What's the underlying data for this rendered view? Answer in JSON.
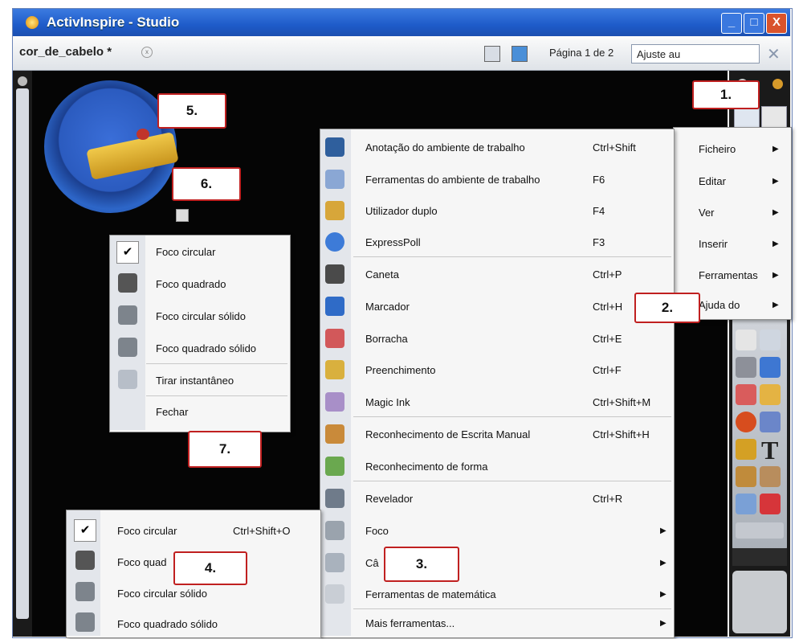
{
  "window": {
    "title": "ActivInspire - Studio",
    "min_label": "_",
    "max_label": "□",
    "close_label": "X"
  },
  "tab": {
    "label": "cor_de_cabelo *",
    "close_label": "x"
  },
  "toolbar": {
    "page_indicator": "Página 1 de 2",
    "zoom_value": "Ajuste au"
  },
  "main_menu": [
    {
      "label": "Ficheiro",
      "arrow": "▶"
    },
    {
      "label": "Editar",
      "arrow": "▶"
    },
    {
      "label": "Ver",
      "arrow": "▶"
    },
    {
      "label": "Inserir",
      "arrow": "▶"
    },
    {
      "label": "Ferramentas",
      "arrow": "▶"
    },
    {
      "label": "Ajuda do",
      "arrow": "▶"
    }
  ],
  "tools_menu": [
    {
      "label": "Anotação do ambiente de trabalho",
      "shortcut": "Ctrl+Shift",
      "icon": "desktop-annotation-icon"
    },
    {
      "label": "Ferramentas do ambiente de trabalho",
      "shortcut": "F6",
      "icon": "desktop-tools-icon"
    },
    {
      "label": "Utilizador duplo",
      "shortcut": "F4",
      "icon": "dual-user-icon"
    },
    {
      "label": "ExpressPoll",
      "shortcut": "F3",
      "icon": "expresspoll-icon"
    },
    {
      "label": "Caneta",
      "shortcut": "Ctrl+P",
      "icon": "pen-icon"
    },
    {
      "label": "Marcador",
      "shortcut": "Ctrl+H",
      "icon": "highlighter-icon"
    },
    {
      "label": "Borracha",
      "shortcut": "Ctrl+E",
      "icon": "eraser-icon"
    },
    {
      "label": "Preenchimento",
      "shortcut": "Ctrl+F",
      "icon": "fill-icon"
    },
    {
      "label": "Magic Ink",
      "shortcut": "Ctrl+Shift+M",
      "icon": "magic-ink-icon"
    },
    {
      "label": "Reconhecimento de Escrita Manual",
      "shortcut": "Ctrl+Shift+H",
      "icon": "handwriting-icon"
    },
    {
      "label": "Reconhecimento de forma",
      "shortcut": "",
      "icon": "shape-recognition-icon"
    },
    {
      "label": "Revelador",
      "shortcut": "Ctrl+R",
      "icon": "revealer-icon"
    },
    {
      "label": "Foco",
      "shortcut": "",
      "icon": "spotlight-icon",
      "arrow": "▶"
    },
    {
      "label": "Câ",
      "shortcut": "",
      "icon": "camera-icon",
      "arrow": "▶"
    },
    {
      "label": "Ferramentas de matemática",
      "shortcut": "",
      "icon": "calculator-icon",
      "arrow": "▶"
    },
    {
      "label": "Mais ferramentas...",
      "shortcut": "",
      "icon": "",
      "arrow": "▶"
    }
  ],
  "focus_menu_top": [
    {
      "label": "Foco circular",
      "checked": true,
      "icon": "check-icon"
    },
    {
      "label": "Foco quadrado",
      "icon": "square-spotlight-icon"
    },
    {
      "label": "Foco circular sólido",
      "icon": "solid-circle-spotlight-icon"
    },
    {
      "label": "Foco quadrado sólido",
      "icon": "solid-square-spotlight-icon"
    },
    {
      "label": "Tirar instantâneo",
      "icon": "snapshot-icon"
    },
    {
      "label": "Fechar",
      "icon": ""
    }
  ],
  "focus_menu_bottom": [
    {
      "label": "Foco circular",
      "shortcut": "Ctrl+Shift+O",
      "checked": true
    },
    {
      "label": "Foco quad"
    },
    {
      "label": "Foco circular sólido"
    },
    {
      "label": "Foco quadrado sólido"
    }
  ],
  "check_glyph": "✔",
  "callouts": {
    "c1": "1.",
    "c2": "2.",
    "c3": "3.",
    "c4": "4.",
    "c5": "5.",
    "c6": "6.",
    "c7": "7."
  },
  "palette_glyphs": {
    "text_tool": "T"
  },
  "colors": {
    "titlebar": "#1e5bc9",
    "callout_border": "#c02020",
    "canvas": "#050505"
  }
}
